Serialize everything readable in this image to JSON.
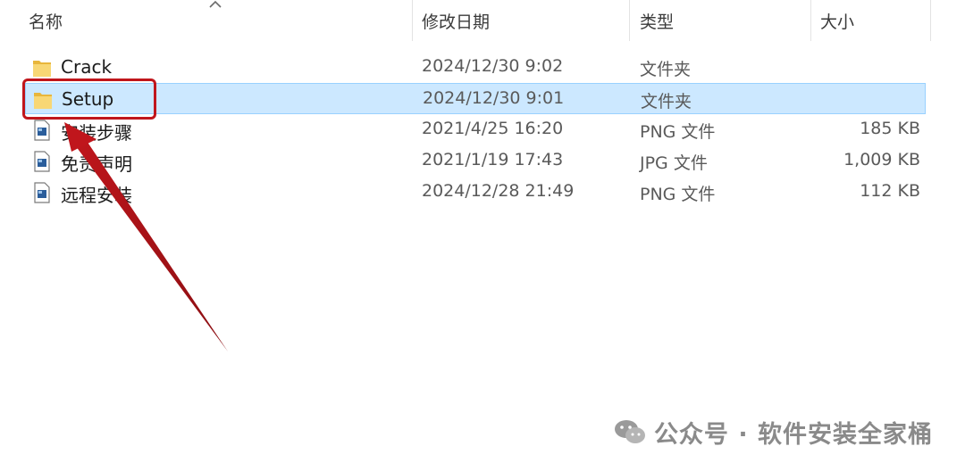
{
  "columns": {
    "name": "名称",
    "date": "修改日期",
    "type": "类型",
    "size": "大小"
  },
  "files": [
    {
      "name": "Crack",
      "date": "2024/12/30 9:02",
      "type": "文件夹",
      "size": "",
      "icon": "folder-icon",
      "selected": false
    },
    {
      "name": "Setup",
      "date": "2024/12/30 9:01",
      "type": "文件夹",
      "size": "",
      "icon": "folder-icon",
      "selected": true
    },
    {
      "name": "安装步骤",
      "date": "2021/4/25 16:20",
      "type": "PNG 文件",
      "size": "185 KB",
      "icon": "image-file-icon",
      "selected": false
    },
    {
      "name": "免责声明",
      "date": "2021/1/19 17:43",
      "type": "JPG 文件",
      "size": "1,009 KB",
      "icon": "image-file-icon",
      "selected": false
    },
    {
      "name": "远程安装",
      "date": "2024/12/28 21:49",
      "type": "PNG 文件",
      "size": "112 KB",
      "icon": "image-file-icon",
      "selected": false
    }
  ],
  "watermark": {
    "text": "公众号 · 软件安装全家桶",
    "icon": "wechat-icon"
  },
  "colors": {
    "selection": "#cce8ff",
    "selection_border": "#99d1ff",
    "annotation": "#c0161c",
    "folder": "#f8d775"
  }
}
